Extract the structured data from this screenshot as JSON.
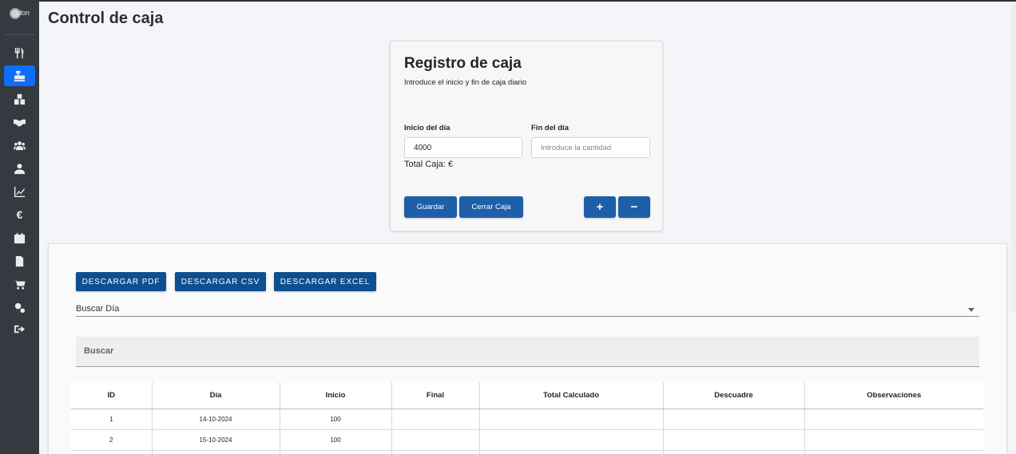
{
  "sidebar": {
    "logo_text": "don",
    "items": [
      {
        "icon": "utensils-icon",
        "name": "sidebar-item-restaurant",
        "active": false
      },
      {
        "icon": "cash-register-icon",
        "name": "sidebar-item-cash-control",
        "active": true
      },
      {
        "icon": "boxes-icon",
        "name": "sidebar-item-inventory",
        "active": false
      },
      {
        "icon": "handshake-icon",
        "name": "sidebar-item-suppliers",
        "active": false
      },
      {
        "icon": "users-icon",
        "name": "sidebar-item-staff",
        "active": false
      },
      {
        "icon": "user-tie-icon",
        "name": "sidebar-item-clients",
        "active": false
      },
      {
        "icon": "chart-line-icon",
        "name": "sidebar-item-stats",
        "active": false
      },
      {
        "icon": "euro-icon",
        "name": "sidebar-item-finance",
        "active": false
      },
      {
        "icon": "calendar-icon",
        "name": "sidebar-item-calendar",
        "active": false
      },
      {
        "icon": "invoice-icon",
        "name": "sidebar-item-invoices",
        "active": false
      },
      {
        "icon": "cart-icon",
        "name": "sidebar-item-orders",
        "active": false
      },
      {
        "icon": "cogs-icon",
        "name": "sidebar-item-settings",
        "active": false
      },
      {
        "icon": "logout-icon",
        "name": "sidebar-item-logout",
        "active": false
      }
    ],
    "euro_glyph": "€",
    "active_color": "#0d6efd"
  },
  "page": {
    "title": "Control de caja"
  },
  "card": {
    "title": "Registro de caja",
    "subtitle": "Introduce el inicio y fin de caja diario",
    "start_label": "Inicio del día",
    "start_value": "4000",
    "end_label": "Fin del día",
    "end_placeholder": "Introduce la cantidad",
    "total_text": "Total Caja: €",
    "save_label": "Guardar",
    "close_label": "Cerrar Caja",
    "plus_label": "+",
    "minus_label": "−",
    "button_color": "#1f5ea8"
  },
  "export": {
    "pdf_label": "DESCARGAR PDF",
    "csv_label": "DESCARGAR CSV",
    "excel_label": "DESCARGAR EXCEL",
    "button_color": "#0d4f8f"
  },
  "filter": {
    "day_select_label": "Buscar Día",
    "search_label": "Buscar"
  },
  "table": {
    "headers": [
      "ID",
      "Día",
      "Inicio",
      "Final",
      "Total Calculado",
      "Descuadre",
      "Observaciones"
    ],
    "rows": [
      [
        "1",
        "14-10-2024",
        "100",
        "",
        "",
        "",
        ""
      ],
      [
        "2",
        "15-10-2024",
        "100",
        "",
        "",
        "",
        ""
      ],
      [
        "",
        "",
        "",
        "",
        "",
        "",
        ""
      ]
    ]
  }
}
